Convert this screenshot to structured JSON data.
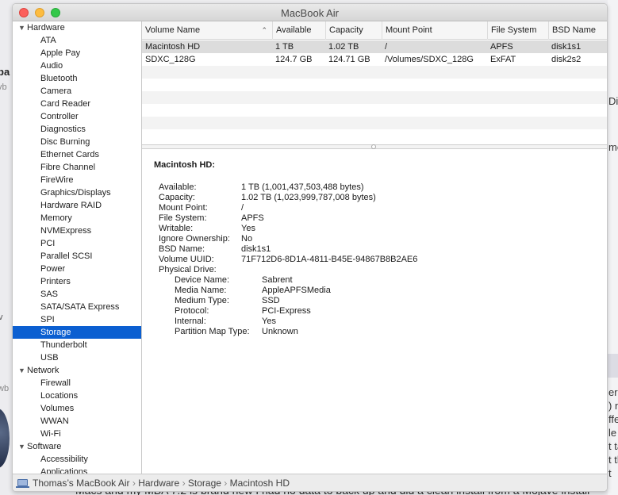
{
  "background": {
    "left_snippets": [
      "pa",
      "vb",
      "v",
      "wb"
    ],
    "right_snippets": [
      "Di",
      "me",
      "er",
      ") n",
      "ffe",
      "le",
      "t ta",
      "t th",
      "t",
      "nstal"
    ],
    "bottom_text": "Macs and my MBA 7.2 is brand new I had no data to back up and did a clean install from a Mojave install"
  },
  "window": {
    "title": "MacBook Air"
  },
  "sidebar": {
    "groups": [
      {
        "label": "Hardware",
        "items": [
          "ATA",
          "Apple Pay",
          "Audio",
          "Bluetooth",
          "Camera",
          "Card Reader",
          "Controller",
          "Diagnostics",
          "Disc Burning",
          "Ethernet Cards",
          "Fibre Channel",
          "FireWire",
          "Graphics/Displays",
          "Hardware RAID",
          "Memory",
          "NVMExpress",
          "PCI",
          "Parallel SCSI",
          "Power",
          "Printers",
          "SAS",
          "SATA/SATA Express",
          "SPI",
          "Storage",
          "Thunderbolt",
          "USB"
        ]
      },
      {
        "label": "Network",
        "items": [
          "Firewall",
          "Locations",
          "Volumes",
          "WWAN",
          "Wi-Fi"
        ]
      },
      {
        "label": "Software",
        "items": [
          "Accessibility",
          "Applications"
        ]
      }
    ],
    "selected": "Storage"
  },
  "table": {
    "columns": [
      "Volume Name",
      "Available",
      "Capacity",
      "Mount Point",
      "File System",
      "BSD Name"
    ],
    "rows": [
      [
        "Macintosh HD",
        "1 TB",
        "1.02 TB",
        "/",
        "APFS",
        "disk1s1"
      ],
      [
        "SDXC_128G",
        "124.7 GB",
        "124.71 GB",
        "/Volumes/SDXC_128G",
        "ExFAT",
        "disk2s2"
      ]
    ]
  },
  "detail": {
    "title": "Macintosh HD:",
    "fields": [
      {
        "label": "Available:",
        "value": "1 TB (1,001,437,503,488 bytes)"
      },
      {
        "label": "Capacity:",
        "value": "1.02 TB (1,023,999,787,008 bytes)"
      },
      {
        "label": "Mount Point:",
        "value": "/"
      },
      {
        "label": "File System:",
        "value": "APFS"
      },
      {
        "label": "Writable:",
        "value": "Yes"
      },
      {
        "label": "Ignore Ownership:",
        "value": "No"
      },
      {
        "label": "BSD Name:",
        "value": "disk1s1"
      },
      {
        "label": "Volume UUID:",
        "value": "71F712D6-8D1A-4811-B45E-94867B8B2AE6"
      },
      {
        "label": "Physical Drive:",
        "value": ""
      }
    ],
    "physical_drive": [
      {
        "label": "Device Name:",
        "value": "Sabrent"
      },
      {
        "label": "Media Name:",
        "value": "AppleAPFSMedia"
      },
      {
        "label": "Medium Type:",
        "value": "SSD"
      },
      {
        "label": "Protocol:",
        "value": "PCI-Express"
      },
      {
        "label": "Internal:",
        "value": "Yes"
      },
      {
        "label": "Partition Map Type:",
        "value": "Unknown"
      }
    ]
  },
  "pathbar": {
    "items": [
      "Thomas’s MacBook Air",
      "Hardware",
      "Storage",
      "Macintosh HD"
    ],
    "separator": "›"
  },
  "colors": {
    "selection": "#0b5fd1",
    "close": "#fc605c",
    "minimize": "#fdbc40",
    "maximize": "#34c84a"
  }
}
